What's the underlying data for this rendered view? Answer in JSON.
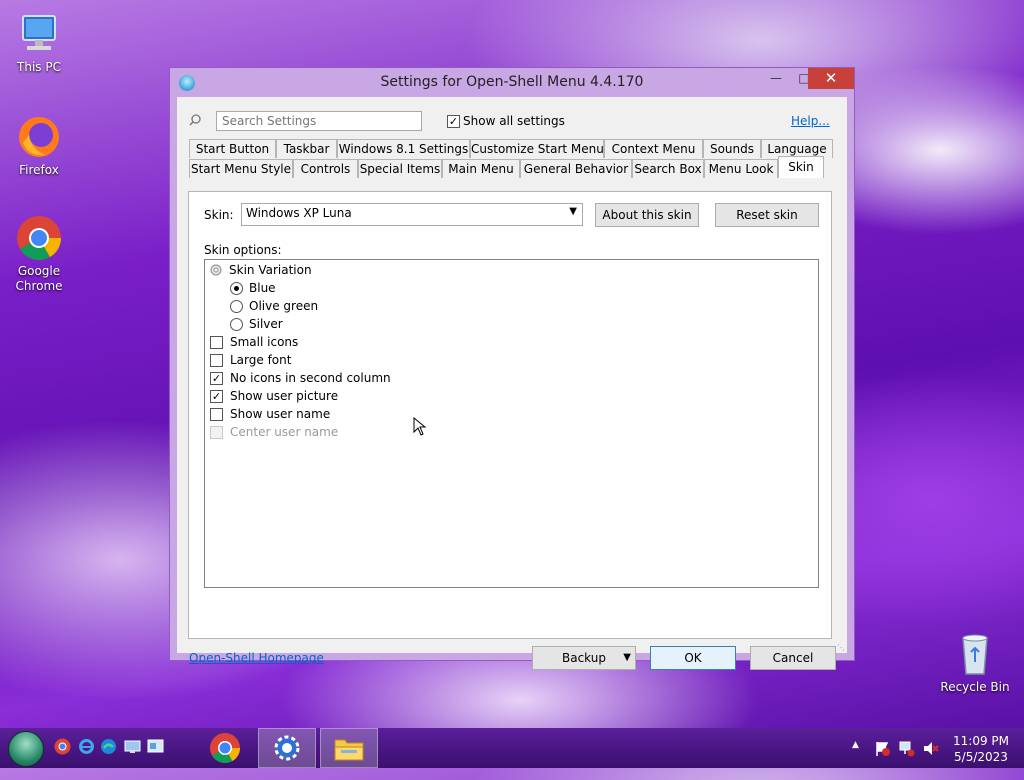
{
  "desktop": {
    "icons": [
      {
        "label": "This PC"
      },
      {
        "label": "Firefox"
      },
      {
        "label": "Google\nChrome",
        "line1": "Google",
        "line2": "Chrome"
      },
      {
        "label": "Recycle Bin"
      }
    ]
  },
  "window": {
    "title": "Settings for Open-Shell Menu 4.4.170",
    "search_placeholder": "Search Settings",
    "show_all_label": "Show all settings",
    "show_all_checked": true,
    "help_link": "Help...",
    "tabs_row1": [
      "Start Button",
      "Taskbar",
      "Windows 8.1 Settings",
      "Customize Start Menu",
      "Context Menu",
      "Sounds",
      "Language"
    ],
    "tabs_row2": [
      "Start Menu Style",
      "Controls",
      "Special Items",
      "Main Menu",
      "General Behavior",
      "Search Box",
      "Menu Look",
      "Skin"
    ],
    "active_tab": "Skin",
    "skin": {
      "label": "Skin:",
      "selected": "Windows XP Luna",
      "about_button": "About this skin",
      "reset_button": "Reset skin",
      "options_label": "Skin options:",
      "variation_label": "Skin Variation",
      "variations": [
        {
          "label": "Blue",
          "selected": true
        },
        {
          "label": "Olive green",
          "selected": false
        },
        {
          "label": "Silver",
          "selected": false
        }
      ],
      "options": [
        {
          "label": "Small icons",
          "checked": false,
          "enabled": true
        },
        {
          "label": "Large font",
          "checked": false,
          "enabled": true
        },
        {
          "label": "No icons in second column",
          "checked": true,
          "enabled": true
        },
        {
          "label": "Show user picture",
          "checked": true,
          "enabled": true
        },
        {
          "label": "Show user name",
          "checked": false,
          "enabled": true
        },
        {
          "label": "Center user name",
          "checked": false,
          "enabled": false
        }
      ]
    },
    "footer": {
      "homepage_link": "Open-Shell Homepage",
      "backup_button": "Backup",
      "ok_button": "OK",
      "cancel_button": "Cancel"
    }
  },
  "taskbar": {
    "clock_time": "11:09 PM",
    "clock_date": "5/5/2023"
  },
  "colors": {
    "close_button": "#c7403a",
    "link": "#0066cc",
    "window_frame": "#c9a6e4",
    "taskbar": "#4a1585"
  }
}
